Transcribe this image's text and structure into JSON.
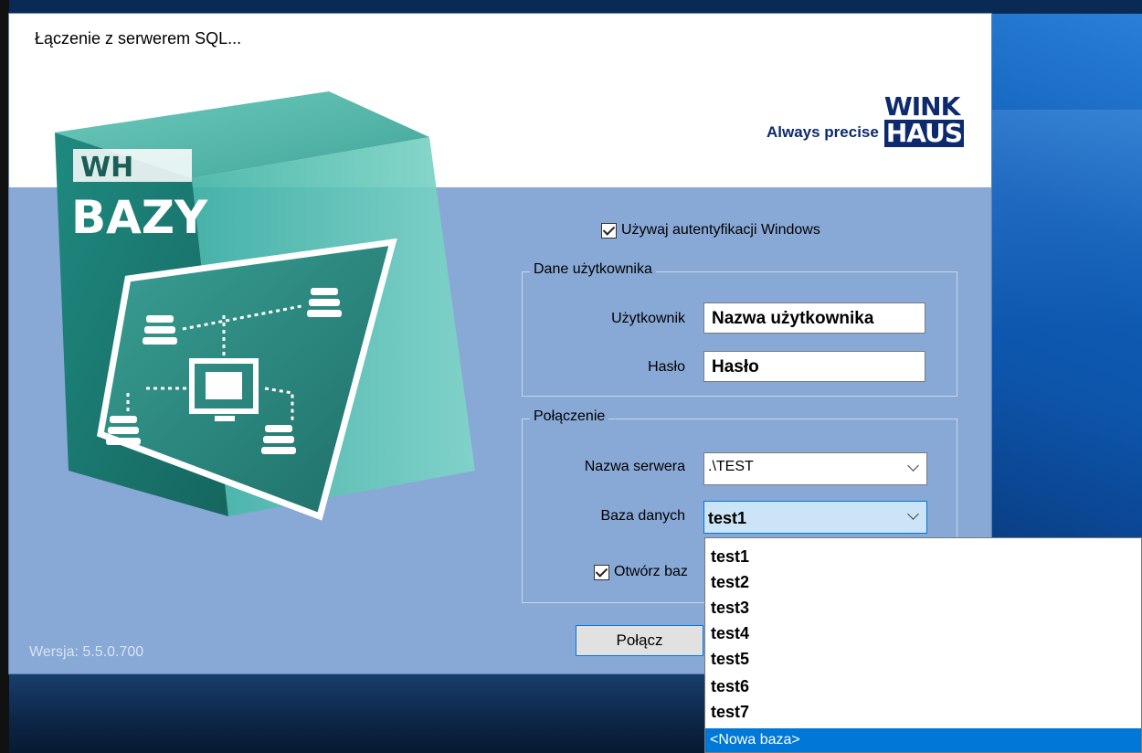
{
  "dialog": {
    "title": "Łączenie z serwerem SQL...",
    "logo": {
      "tagline": "Always precise",
      "brand_top": "WINK",
      "brand_bottom": "HAUS"
    },
    "product": {
      "line1": "WH",
      "line2": "BAZY"
    },
    "version": "Wersja: 5.5.0.700"
  },
  "form": {
    "windows_auth_label": "Używaj autentyfikacji Windows",
    "windows_auth_checked": true,
    "user_group": {
      "title": "Dane użytkownika",
      "user_label": "Użytkownik",
      "user_value": "Nazwa użytkownika",
      "password_label": "Hasło",
      "password_value": "Hasło"
    },
    "connection_group": {
      "title": "Połączenie",
      "server_label": "Nazwa serwera",
      "server_value": ".\\TEST",
      "database_label": "Baza danych",
      "database_value": "test1",
      "open_db_label": "Otwórz baz",
      "open_db_checked": true
    },
    "connect_button": "Połącz"
  },
  "database_dropdown": {
    "items": [
      "test1",
      "test2",
      "test3",
      "test4",
      "test5",
      "test6",
      "test7"
    ],
    "new_item": "<Nowa baza>"
  },
  "colors": {
    "dialog_bg": "#88a8d6",
    "accent": "#0078d7",
    "brand": "#0e2a6e",
    "box_teal": "#2a9a8c"
  }
}
